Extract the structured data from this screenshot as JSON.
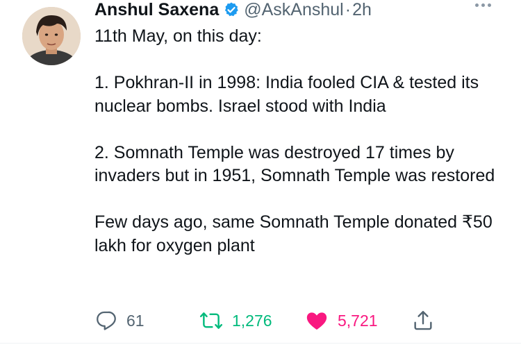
{
  "tweet": {
    "author_name": "Anshul Saxena",
    "handle": "@AskAnshul",
    "separator": "·",
    "time": "2h",
    "verified": true,
    "paragraphs": [
      "11th May, on this day:",
      "1. Pokhran-II in 1998: India fooled CIA & tested its nuclear bombs. Israel stood with India",
      "2. Somnath Temple was destroyed 17 times by invaders but in 1951, Somnath Temple was restored",
      "Few days ago, same Somnath Temple donated ₹50 lakh for oxygen plant"
    ]
  },
  "actions": {
    "replies": "61",
    "retweets": "1,276",
    "likes": "5,721",
    "liked": true,
    "retweeted": false
  },
  "colors": {
    "verified_blue": "#1d9bf0",
    "retweet_green": "#00ba7c",
    "like_pink": "#f91880",
    "muted_text": "#536471",
    "primary_text": "#0f1419"
  },
  "icons": {
    "more": "more-dots-icon",
    "reply": "reply-bubble-icon",
    "retweet": "retweet-arrows-icon",
    "like": "heart-icon",
    "share": "share-upload-icon",
    "verified": "verified-badge-icon"
  }
}
